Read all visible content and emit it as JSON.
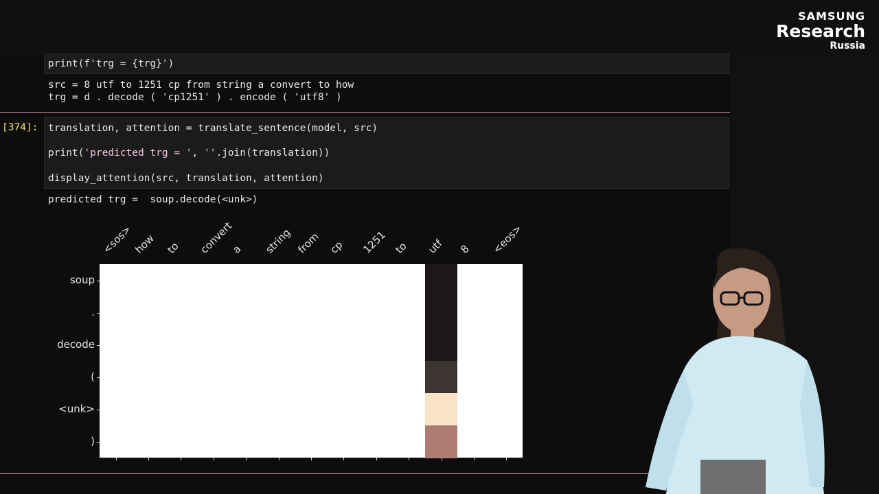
{
  "logo": {
    "line1": "SAMSUNG",
    "line2": "Research",
    "line3": "Russia"
  },
  "cells": {
    "prev": {
      "code_line": "print(f'trg = {trg}')",
      "output": [
        "src = 8 utf to 1251 cp from string a convert to how",
        "trg = d . decode ( 'cp1251' ) . encode ( 'utf8' )"
      ]
    },
    "current": {
      "prompt": "[374]:",
      "line1": "translation, attention = translate_sentence(model, src)",
      "line2_a": "print(",
      "line2_str": "'predicted trg = '",
      "line2_b": ", ",
      "line2_str2": "''",
      "line2_c": ".join(translation))",
      "line3": "display_attention(src, translation, attention)",
      "output": "predicted trg =  soup.decode(<unk>)"
    }
  },
  "chart_data": {
    "type": "heatmap",
    "x_labels": [
      "<sos>",
      "how",
      "to",
      "convert",
      "a",
      "string",
      "from",
      "cp",
      "1251",
      "to",
      "utf",
      "8",
      "<eos>"
    ],
    "y_labels": [
      "soup",
      ".",
      "decode",
      "(",
      "<unk>",
      ")"
    ],
    "highlight_column": "utf",
    "highlight_column_index": 10,
    "column_colors": [
      "#1b1817",
      "#1b1817",
      "#1b1817",
      "#3d3532",
      "#f9e5c6",
      "#ae7c72"
    ],
    "background_color": "#ffffff"
  }
}
